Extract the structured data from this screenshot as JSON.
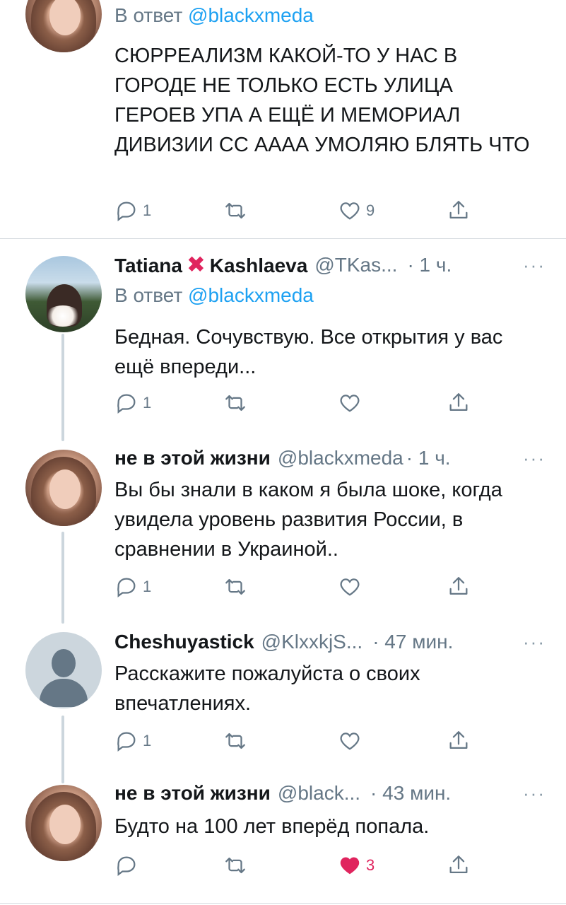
{
  "tweets": [
    {
      "reply_prefix": "В ответ",
      "reply_handle": "@blackxmeda",
      "text": "СЮРРЕАЛИЗМ КАКОЙ-ТО У НАС В ГОРОДЕ НЕ ТОЛЬКО ЕСТЬ УЛИЦА ГЕРОЕВ УПА А ЕЩЁ И МЕМОРИАЛ ДИВИЗИИ СС АААА УМОЛЯЮ БЛЯТЬ ЧТО",
      "reply_count": "1",
      "retweet_count": "",
      "like_count": "9"
    },
    {
      "name_first": "Tatiana",
      "name_emoji": "✖",
      "name_last": "Kashlaeva",
      "handle": "@TKas...",
      "time": "· 1 ч.",
      "reply_prefix": "В ответ",
      "reply_handle": "@blackxmeda",
      "text": "Бедная. Сочувствую. Все открытия у вас ещё впереди...",
      "reply_count": "1",
      "like_count": ""
    },
    {
      "name": "не в этой жизни",
      "handle": "@blackxmeda",
      "time": "· 1 ч.",
      "text": "Вы бы знали в каком я была шоке, когда увидела уровень развития России, в сравнении в Украиной..",
      "reply_count": "1",
      "like_count": ""
    },
    {
      "name": "Cheshuyastick",
      "handle": "@KlxxkjS...",
      "time": "· 47 мин.",
      "text": "Расскажите пожалуйста о своих впечатлениях.",
      "reply_count": "1",
      "like_count": ""
    },
    {
      "name": "не в этой жизни",
      "handle": "@black...",
      "time": "· 43 мин.",
      "text": "Будто на 100 лет вперёд попала.",
      "reply_count": "",
      "like_count": "3"
    }
  ],
  "more_glyph": "···",
  "colors": {
    "accent": "#1da1f2",
    "muted": "#657786",
    "like": "#e0245e",
    "thread_line": "#ccd6dd"
  }
}
